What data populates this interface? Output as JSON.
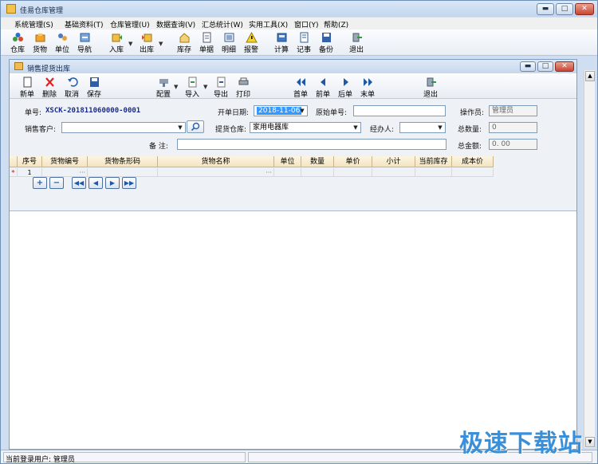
{
  "window": {
    "title": "佳易仓库管理",
    "min": "▬",
    "max": "□",
    "close": "✕"
  },
  "menu": [
    "系统管理(S)",
    "基础资料(T)",
    "仓库管理(U)",
    "数据查询(V)",
    "汇总统计(W)",
    "实用工具(X)",
    "窗口(Y)",
    "帮助(Z)"
  ],
  "toolbar": [
    "仓库",
    "货物",
    "单位",
    "导航",
    "入库",
    "出库",
    "库存",
    "单据",
    "明细",
    "报警",
    "计算",
    "记事",
    "备份",
    "退出"
  ],
  "child": {
    "title": "销售提货出库",
    "toolbar": [
      "新单",
      "删除",
      "取消",
      "保存",
      "配置",
      "导入",
      "导出",
      "打印",
      "首单",
      "前单",
      "后单",
      "末单",
      "退出"
    ]
  },
  "form": {
    "order_no_label": "单号:",
    "order_no": "XSCK-201811060000-0001",
    "date_label": "开单日期:",
    "date": "2018-11-06",
    "orig_no_label": "原始单号:",
    "operator_label": "操作员:",
    "operator": "管理员",
    "customer_label": "销售客户:",
    "warehouse_label": "提货仓库:",
    "warehouse": "家用电器库",
    "handler_label": "经办人:",
    "total_qty_label": "总数量:",
    "total_qty": "0",
    "remark_label": "备 注:",
    "total_amt_label": "总金额:",
    "total_amt": "0. 00"
  },
  "grid": {
    "columns": [
      "序号",
      "货物编号",
      "货物条形码",
      "货物名称",
      "单位",
      "数量",
      "单价",
      "小计",
      "当前库存",
      "成本价"
    ],
    "rows": [
      {
        "marker": "*",
        "seq": "1",
        "ellipsis1": "···",
        "ellipsis2": "···"
      }
    ]
  },
  "status": {
    "user": "当前登录用户: 管理员"
  },
  "watermark": "极速下载站",
  "colors": {
    "accent": "#1f58a8",
    "grid_header": "#f3e4c1",
    "title_bg": "#c3d6ee"
  }
}
